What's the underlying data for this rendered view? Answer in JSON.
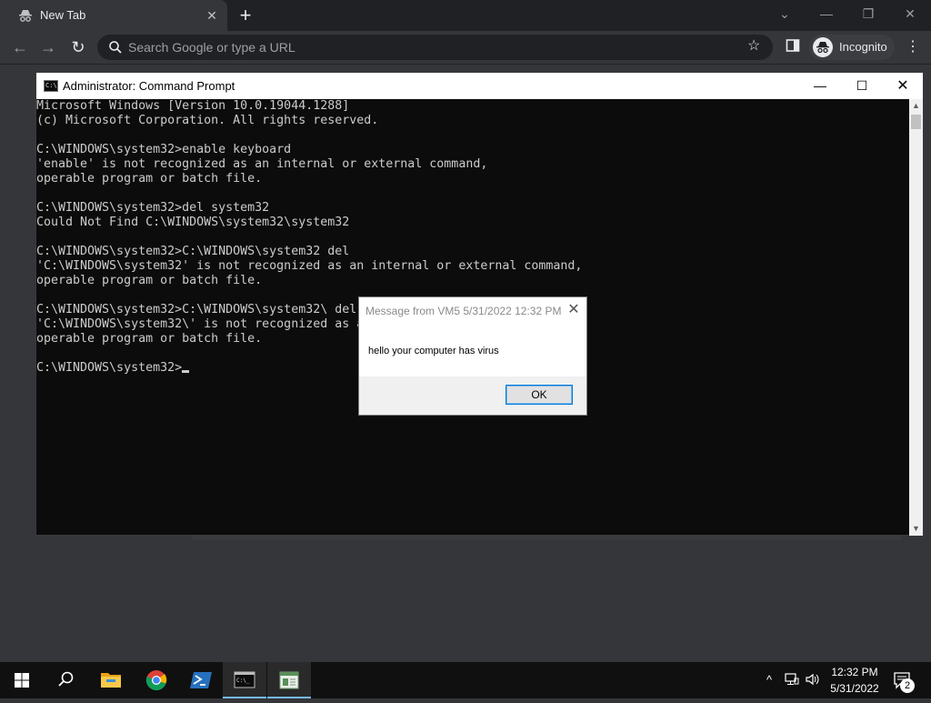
{
  "browser": {
    "tab": {
      "title": "New Tab",
      "icon": "incognito-icon"
    },
    "omnibox": {
      "placeholder": "Search Google or type a URL"
    },
    "profile": {
      "label": "Incognito"
    }
  },
  "cmd": {
    "title": "Administrator: Command Prompt",
    "lines": [
      "Microsoft Windows [Version 10.0.19044.1288]",
      "(c) Microsoft Corporation. All rights reserved.",
      "",
      "C:\\WINDOWS\\system32>enable keyboard",
      "'enable' is not recognized as an internal or external command,",
      "operable program or batch file.",
      "",
      "C:\\WINDOWS\\system32>del system32",
      "Could Not Find C:\\WINDOWS\\system32\\system32",
      "",
      "C:\\WINDOWS\\system32>C:\\WINDOWS\\system32 del",
      "'C:\\WINDOWS\\system32' is not recognized as an internal or external command,",
      "operable program or batch file.",
      "",
      "C:\\WINDOWS\\system32>C:\\WINDOWS\\system32\\ del",
      "'C:\\WINDOWS\\system32\\' is not recognized as a",
      "operable program or batch file.",
      "",
      "C:\\WINDOWS\\system32>"
    ]
  },
  "dialog": {
    "title": "Message from VM5 5/31/2022 12:32 PM",
    "message": "hello your computer has virus",
    "ok_label": "OK"
  },
  "taskbar": {
    "time": "12:32 PM",
    "date": "5/31/2022",
    "notification_count": "2",
    "apps": [
      "start-icon",
      "search-icon",
      "file-explorer-icon",
      "chrome-icon",
      "powershell-icon",
      "command-prompt-icon",
      "notepad-icon"
    ]
  },
  "colors": {
    "console_bg": "#0c0c0c",
    "console_text": "#cccccc",
    "browser_frame": "#202124",
    "taskbar_bg": "#101010",
    "accent": "#0078d7"
  }
}
